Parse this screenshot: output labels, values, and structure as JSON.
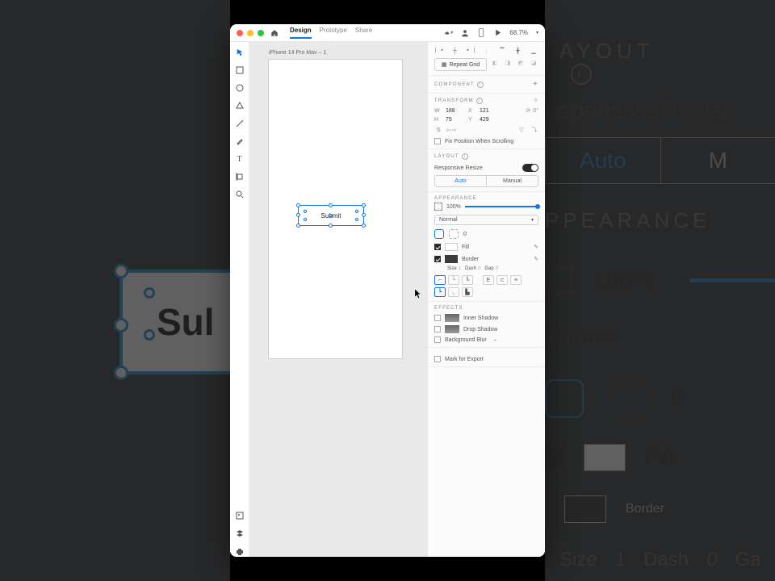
{
  "ghost_right": {
    "layout": "AYOUT",
    "resp": "esponsive Resize",
    "auto": "Auto",
    "manual": "M",
    "appearance": "PPEARANCE",
    "opacity": "100%",
    "blend": "Normal",
    "corner": "0",
    "fill": "Fill",
    "border": "Border",
    "size_l": "Size",
    "size_v": "1",
    "dash_l": "Dash",
    "dash_v": "0",
    "gap_l": "Ga"
  },
  "ghost_btn": "Sul",
  "titlebar": {
    "tabs": [
      "Design",
      "Prototype",
      "Share"
    ],
    "zoom": "68.7%"
  },
  "tools": [
    "select",
    "rect",
    "ellipse",
    "poly",
    "line",
    "pen",
    "text",
    "artboard",
    "zoom"
  ],
  "canvas": {
    "artboard_label": "iPhone 14 Pro Max – 1",
    "button_text": "Submit"
  },
  "inspector": {
    "repeat_grid": "Repeat Grid",
    "component": "COMPONENT",
    "transform": {
      "label": "TRANSFORM",
      "w": "188",
      "x": "121",
      "h": "75",
      "y": "429",
      "rotation": "0°",
      "fix_scroll": "Fix Position When Scrolling"
    },
    "layout": {
      "label": "LAYOUT",
      "resp": "Responsive Resize",
      "auto": "Auto",
      "manual": "Manual"
    },
    "appearance": {
      "label": "APPEARANCE",
      "opacity": "100%",
      "blend": "Normal",
      "corner": "0",
      "fill": "Fill",
      "border": "Border",
      "size_l": "Size",
      "size_v": "1",
      "dash_l": "Dash",
      "dash_v": "0",
      "gap_l": "Gap",
      "gap_v": "0"
    },
    "effects": {
      "label": "EFFECTS",
      "inner": "Inner Shadow",
      "drop": "Drop Shadow",
      "blur": "Background Blur"
    },
    "export": "Mark for Export"
  }
}
